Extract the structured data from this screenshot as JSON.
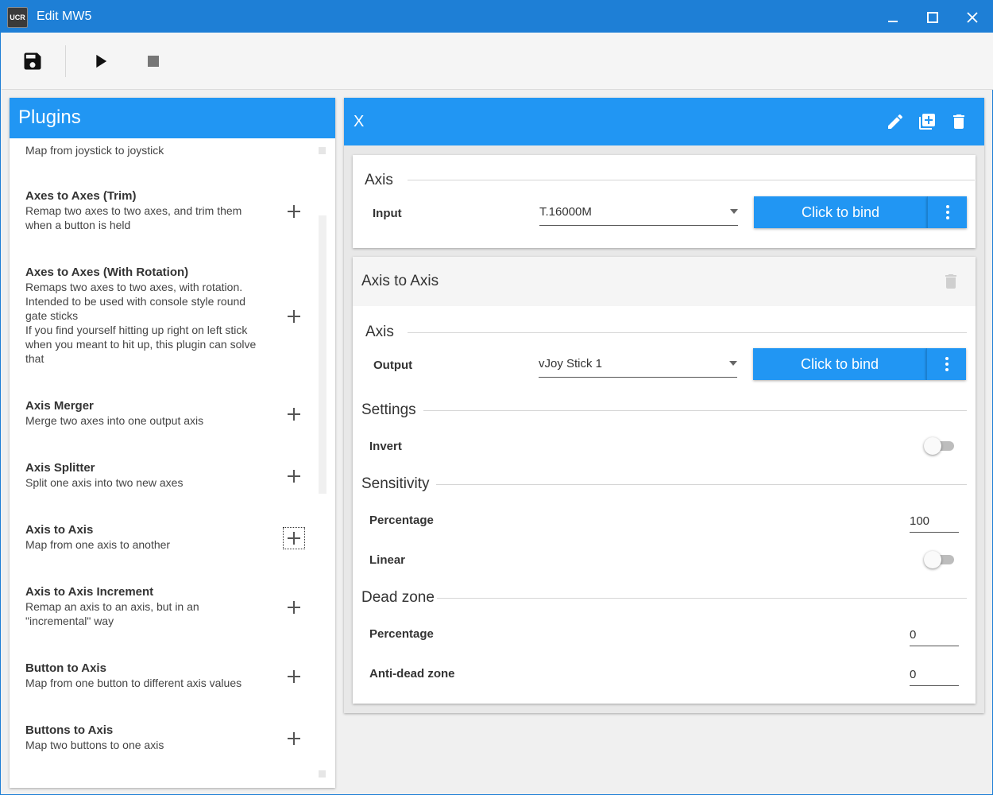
{
  "window": {
    "title": "Edit MW5",
    "app_icon_text": "UCR"
  },
  "toolbar": {
    "save_icon": "save-icon",
    "play_icon": "play-icon",
    "stop_icon": "stop-icon"
  },
  "plugins": {
    "title": "Plugins",
    "items": [
      {
        "name": "",
        "desc": "Map from joystick to joystick"
      },
      {
        "name": "Axes to Axes (Trim)",
        "desc": "Remap two axes to two axes, and trim them\nwhen a button is held"
      },
      {
        "name": "Axes to Axes (With Rotation)",
        "desc": "Remaps two axes to two axes, with rotation.\nIntended to be used with console style round\ngate sticks\nIf you find yourself hitting up right on left stick\nwhen you meant to hit up, this plugin can solve\nthat"
      },
      {
        "name": "Axis Merger",
        "desc": "Merge two axes into one output axis"
      },
      {
        "name": "Axis Splitter",
        "desc": "Split one axis into two new axes"
      },
      {
        "name": "Axis to Axis",
        "desc": "Map from one axis to another"
      },
      {
        "name": "Axis to Axis Increment",
        "desc": "Remap an axis to an axis, but in an\n\"incremental\" way"
      },
      {
        "name": "Button to Axis",
        "desc": "Map from one button to different axis values"
      },
      {
        "name": "Buttons to Axis",
        "desc": "Map two buttons to one axis"
      }
    ]
  },
  "mapping": {
    "title": "X",
    "input_card": {
      "section": "Axis",
      "field_label": "Input",
      "device": "T.16000M",
      "bind_label": "Click to bind"
    },
    "plugin_card": {
      "title": "Axis to Axis",
      "axis_section": "Axis",
      "output_label": "Output",
      "output_device": "vJoy Stick 1",
      "bind_label": "Click to bind",
      "settings_section": "Settings",
      "invert_label": "Invert",
      "invert_on": false,
      "sensitivity_section": "Sensitivity",
      "sens_percentage_label": "Percentage",
      "sens_percentage_value": "100",
      "linear_label": "Linear",
      "linear_on": false,
      "deadzone_section": "Dead zone",
      "dz_percentage_label": "Percentage",
      "dz_percentage_value": "0",
      "antidead_label": "Anti-dead zone",
      "antidead_value": "0"
    }
  },
  "colors": {
    "titlebar": "#1e7fd6",
    "accent": "#2196f3"
  }
}
